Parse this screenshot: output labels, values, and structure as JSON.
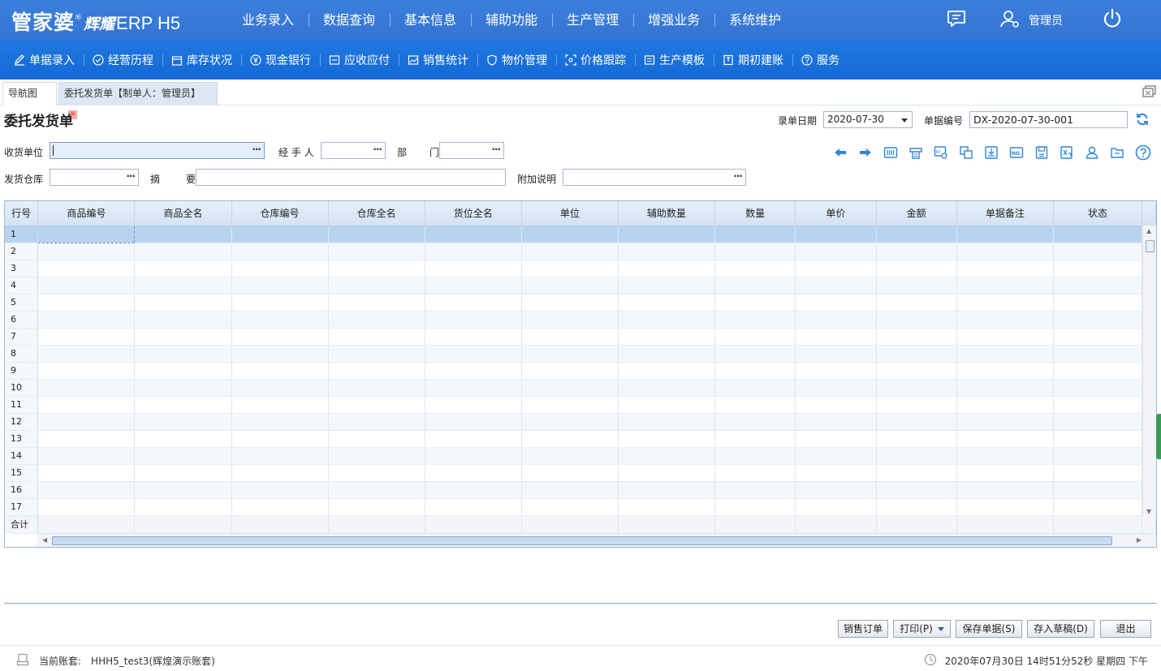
{
  "app": {
    "logo_main": "管家婆",
    "logo_brand": "辉耀",
    "logo_product": "ERP H5",
    "registered_mark": "®"
  },
  "main_nav": [
    "业务录入",
    "数据查询",
    "基本信息",
    "辅助功能",
    "生产管理",
    "增强业务",
    "系统维护"
  ],
  "user": {
    "name": "管理员"
  },
  "sub_nav": [
    "单据录入",
    "经营历程",
    "库存状况",
    "现金银行",
    "应收应付",
    "销售统计",
    "物价管理",
    "价格跟踪",
    "生产模板",
    "期初建账",
    "服务"
  ],
  "tabs": {
    "nav_label": "导航图",
    "active_label": "委托发货单【制单人：管理员】",
    "close_symbol": "×"
  },
  "form": {
    "title": "委托发货单",
    "date_label": "录单日期",
    "date_value": "2020-07-30",
    "docno_label": "单据编号",
    "docno_value": "DX-2020-07-30-001",
    "receiver_label": "收货单位",
    "receiver_value": "",
    "handler_label": "经 手 人",
    "handler_value": "",
    "dept_label": "部　门",
    "dept_value": "",
    "warehouse_label": "发货仓库",
    "warehouse_value": "",
    "summary_label": "摘　要",
    "summary_value": "",
    "note_label": "附加说明",
    "note_value": "",
    "lookup_symbol": "···"
  },
  "grid": {
    "columns": [
      "行号",
      "商品编号",
      "商品全名",
      "仓库编号",
      "仓库全名",
      "货位全名",
      "单位",
      "辅助数量",
      "数量",
      "单价",
      "金额",
      "单据备注",
      "状态"
    ],
    "row_numbers": [
      "1",
      "2",
      "3",
      "4",
      "5",
      "6",
      "7",
      "8",
      "9",
      "10",
      "11",
      "12",
      "13",
      "14",
      "15",
      "16",
      "17"
    ],
    "selected_row": 1,
    "total_label": "合计"
  },
  "buttons": {
    "sales_order": "销售订单",
    "print": "打印(P)",
    "save": "保存单据(S)",
    "draft": "存入草稿(D)",
    "exit": "退出"
  },
  "status": {
    "account_label": "当前账套:",
    "account_value": "HHH5_test3(辉煌演示账套)",
    "datetime": "2020年07月30日 14时51分52秒 星期四 下午"
  },
  "colors": {
    "topbar": "#3674d2",
    "subbar": "#1669d4",
    "grid_header": "#d9e7f6",
    "selected_row": "#b8d3ee"
  }
}
